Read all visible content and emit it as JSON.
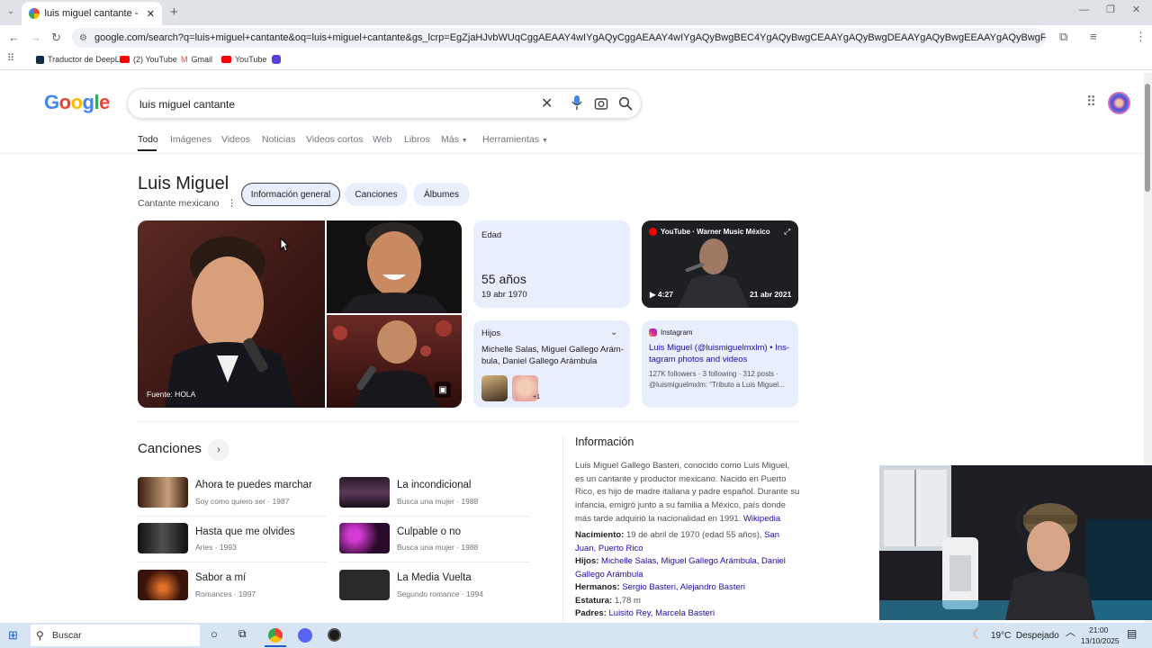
{
  "browser": {
    "tab_title": "luis miguel cantante - Buscar co",
    "url": "google.com/search?q=luis+miguel+cantante&oq=luis+miguel+cantante&gs_lcrp=EgZjaHJvbWUqCggAEAAY4wIYgAQyCggAEAAY4wIYgAQyBwgBEC4YgAQyBwgCEAAYgAQyBwgDEAAYgAQyBwgEEAAYgAQyBwgFEAAYgAQyBwgGEAAYgAQyBwg...",
    "bookmarks": [
      "Traductor de DeepL",
      "(2) YouTube",
      "Gmail",
      "YouTube"
    ]
  },
  "google": {
    "logo": "Google",
    "query": "luis miguel cantante",
    "nav_tabs": [
      "Todo",
      "Imágenes",
      "Videos",
      "Noticias",
      "Videos cortos",
      "Web",
      "Libros",
      "Más",
      "Herramientas"
    ]
  },
  "knowledge_panel": {
    "title": "Luis Miguel",
    "subtitle": "Cantante mexicano",
    "chips": [
      "Información general",
      "Canciones",
      "Álbumes"
    ],
    "photo_source": "Fuente: HOLA",
    "age": {
      "label": "Edad",
      "value": "55 años",
      "date": "19 abr 1970"
    },
    "children": {
      "label": "Hijos",
      "names": "Michelle Salas, Miguel Gallego Arám-bula, Daniel Gallego Arámbula",
      "more": "+1"
    },
    "youtube": {
      "source": "YouTube · Warner Music México",
      "duration": "4:27",
      "date": "21 abr 2021"
    },
    "instagram": {
      "label": "Instagram",
      "title": "Luis Miguel (@luismiguelmxlm) • Ins-tagram photos and videos",
      "stats": "127K followers · 3 following · 312 posts ·",
      "handle": "@luismiguelmxlm: \"Tributo a Luis Miguel..."
    }
  },
  "songs": {
    "title": "Canciones",
    "items": [
      {
        "title": "Ahora te puedes marchar",
        "album": "Soy como quiero ser",
        "year": "1987"
      },
      {
        "title": "La incondicional",
        "album": "Busca una mujer",
        "year": "1988"
      },
      {
        "title": "Hasta que me olvides",
        "album": "Aries",
        "year": "1993"
      },
      {
        "title": "Culpable o no",
        "album": "Busca una mujer",
        "year": "1988"
      },
      {
        "title": "Sabor a mí",
        "album": "Romances",
        "year": "1997"
      },
      {
        "title": "La Media Vuelta",
        "album": "Segundo romance",
        "year": "1994"
      }
    ]
  },
  "info": {
    "title": "Información",
    "description": "Luis Miguel Gallego Basteri,  conocido como Luis Miguel, es un cantante y productor mexicano. Nacido en Puerto Rico, es hijo de madre italiana y padre español. Durante su infancia, emigró junto a su familia a México, país donde más tarde adquirió la nacionalidad en 1991.",
    "wiki_link": "Wikipedia",
    "facts": [
      {
        "label": "Nacimiento:",
        "value": "19 de abril de 1970 (edad 55 años),",
        "links": "San Juan, Puerto Rico"
      },
      {
        "label": "Hijos:",
        "value": "",
        "links": "Michelle Salas, Miguel Gallego Arámbula, Daniel Gallego Arámbula"
      },
      {
        "label": "Hermanos:",
        "value": "",
        "links": "Sergio Basteri, Alejandro Basteri"
      },
      {
        "label": "Estatura:",
        "value": "1,78 m",
        "links": ""
      },
      {
        "label": "Padres:",
        "value": "",
        "links": "Luisito Rey, Marcela Basteri"
      }
    ]
  },
  "taskbar": {
    "search_placeholder": "Buscar",
    "weather": "19°C  Despejado",
    "time": "21:00",
    "date": "13/10/2025"
  },
  "colors": {
    "accent": "#1a0dab",
    "chip_bg": "#e8eefb",
    "taskbar": "#d6e4f3"
  }
}
